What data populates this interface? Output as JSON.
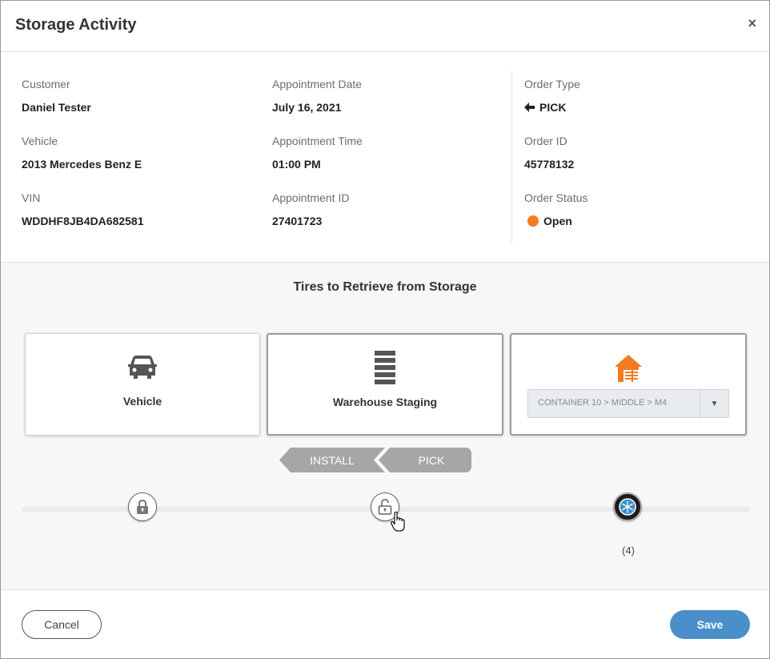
{
  "dialog": {
    "title": "Storage Activity",
    "close_label": "×"
  },
  "info": {
    "customer": {
      "label": "Customer",
      "value": "Daniel Tester"
    },
    "vehicle": {
      "label": "Vehicle",
      "value": "2013 Mercedes Benz E"
    },
    "vin": {
      "label": "VIN",
      "value": "WDDHF8JB4DA682581"
    },
    "appointment_date": {
      "label": "Appointment Date",
      "value": "July 16, 2021"
    },
    "appointment_time": {
      "label": "Appointment Time",
      "value": "01:00 PM"
    },
    "appointment_id": {
      "label": "Appointment ID",
      "value": "27401723"
    },
    "order_type": {
      "label": "Order Type",
      "value": "PICK",
      "icon": "arrow-left-icon"
    },
    "order_id": {
      "label": "Order ID",
      "value": "45778132"
    },
    "order_status": {
      "label": "Order Status",
      "value": "Open",
      "color": "#f47b20"
    }
  },
  "activity": {
    "title": "Tires to Retrieve from Storage",
    "locations": [
      {
        "label": "Vehicle",
        "icon": "car-icon"
      },
      {
        "label": "Warehouse Staging",
        "icon": "shelving-icon"
      },
      {
        "label": "",
        "icon": "warehouse-icon",
        "select_value": "CONTAINER 10 > MIDDLE > M4"
      }
    ],
    "steps": [
      "INSTALL",
      "PICK"
    ],
    "tire_count": "(4)",
    "colors": {
      "warehouse_icon": "#f47b20",
      "step_bg": "#a6a6a6"
    }
  },
  "footer": {
    "cancel_label": "Cancel",
    "save_label": "Save",
    "save_color": "#4a8fc9"
  }
}
